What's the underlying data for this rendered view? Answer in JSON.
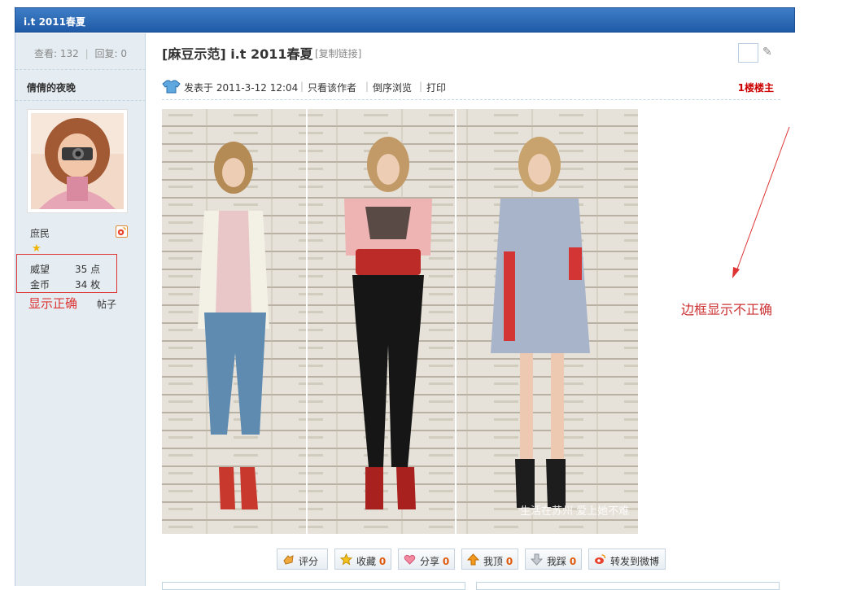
{
  "window": {
    "title": "i.t 2011春夏"
  },
  "sidebar": {
    "views_label": "查看:",
    "views": "132",
    "replies_label": "回复:",
    "replies": "0",
    "author": "倩倩的夜晚",
    "rank": "庶民",
    "info": [
      {
        "label": "威望",
        "value": "35 点"
      },
      {
        "label": "金币",
        "value": "34 枚"
      }
    ],
    "posts_label": "帖子",
    "display_label": "显示正确"
  },
  "post": {
    "title": "[麻豆示范] i.t 2011春夏",
    "copy_link": "[复制链接]",
    "posted_at": "发表于 2011-3-12 12:04",
    "only_author": "只看该作者",
    "reverse": "倒序浏览",
    "print": "打印",
    "floor": "1楼楼主",
    "watermark": "生活在苏州 爱上她不难"
  },
  "annotation": {
    "text": "边框显示不正确"
  },
  "actions": [
    {
      "label": "评分",
      "count": "",
      "icon": "rate-icon"
    },
    {
      "label": "收藏",
      "count": "0",
      "icon": "star-icon"
    },
    {
      "label": "分享",
      "count": "0",
      "icon": "heart-icon"
    },
    {
      "label": "我顶",
      "count": "0",
      "icon": "arrow-up-icon"
    },
    {
      "label": "我踩",
      "count": "0",
      "icon": "arrow-down-icon"
    },
    {
      "label": "转发到微博",
      "count": "",
      "icon": "weibo-icon"
    }
  ],
  "colors": {
    "header": "#2a66b2",
    "sidebar": "#e5edf2",
    "accent_red": "#cc0000",
    "count_orange": "#e05a0c"
  }
}
